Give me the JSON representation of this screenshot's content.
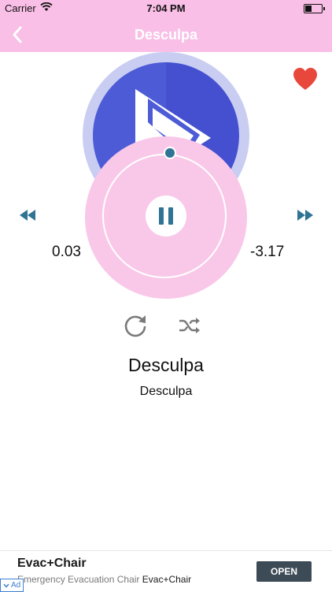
{
  "status_bar": {
    "carrier": "Carrier",
    "time": "7:04 PM"
  },
  "nav": {
    "title": "Desculpa"
  },
  "player": {
    "elapsed": "0.03",
    "remaining": "-3.17",
    "song_title": "Desculpa",
    "artist": "Desculpa",
    "favorite": true
  },
  "ad": {
    "title": "Evac+Chair",
    "text_prefix": "Emergency Evacuation Chair",
    "text_brand": "Evac+Chair",
    "button_label": "OPEN",
    "badge_label": "Ad"
  },
  "colors": {
    "accent": "#f9bfe6",
    "control_pink": "#f9c8e8",
    "art_blue": "#4d5bd6",
    "teal": "#2f7494",
    "heart": "#e8473c"
  },
  "icons": {
    "back": "chevron-left-icon",
    "favorite": "heart-icon",
    "rewind": "rewind-icon",
    "forward": "fast-forward-icon",
    "pause": "pause-icon",
    "repeat": "repeat-icon",
    "shuffle": "shuffle-icon"
  }
}
